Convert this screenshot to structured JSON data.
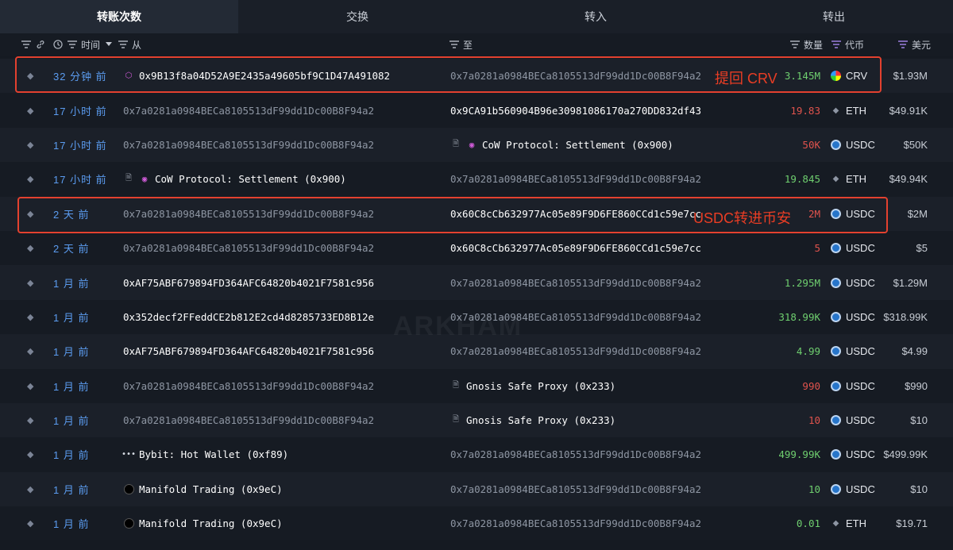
{
  "tabs": [
    "转账次数",
    "交换",
    "转入",
    "转出"
  ],
  "header": {
    "time": "时间",
    "from": "从",
    "to": "至",
    "amount": "数量",
    "token": "代币",
    "usd": "美元"
  },
  "watermark": "ARKHAM",
  "annotations": {
    "crv": "提回 CRV",
    "usdc": "USDC转进币安"
  },
  "colors": {
    "accent_time": "#5b9cf0",
    "in_amount": "#6fcf6f",
    "out_amount": "#e0534d",
    "callout": "#e3412f"
  },
  "rows": [
    {
      "time": "32 分钟 前",
      "from": "0x9B13f8a04D52A9E2435a49605bf9C1D47A491082",
      "from_icon": "hex-icon",
      "to": "0x7a0281a0984BECa8105513dF99dd1Dc00B8F94a2",
      "amount": "3.145M",
      "direction": "in",
      "token": "CRV",
      "usd": "$1.93M"
    },
    {
      "time": "17 小时 前",
      "from": "0x7a0281a0984BECa8105513dF99dd1Dc00B8F94a2",
      "to": "0x9CA91b560904B96e30981086170a270DD832df43",
      "amount": "19.83",
      "direction": "out",
      "token": "ETH",
      "usd": "$49.91K"
    },
    {
      "time": "17 小时 前",
      "from": "0x7a0281a0984BECa8105513dF99dd1Dc00B8F94a2",
      "to": "CoW Protocol: Settlement (0x900)",
      "to_icon": "cow",
      "amount": "50K",
      "direction": "out",
      "token": "USDC",
      "usd": "$50K"
    },
    {
      "time": "17 小时 前",
      "from": "CoW Protocol: Settlement (0x900)",
      "from_icon": "cow",
      "to": "0x7a0281a0984BECa8105513dF99dd1Dc00B8F94a2",
      "amount": "19.845",
      "direction": "in",
      "token": "ETH",
      "usd": "$49.94K"
    },
    {
      "time": "2 天 前",
      "from": "0x7a0281a0984BECa8105513dF99dd1Dc00B8F94a2",
      "to": "0x60C8cCb632977Ac05e89F9D6FE860CCd1c59e7cc",
      "amount": "2M",
      "direction": "out",
      "token": "USDC",
      "usd": "$2M"
    },
    {
      "time": "2 天 前",
      "from": "0x7a0281a0984BECa8105513dF99dd1Dc00B8F94a2",
      "to": "0x60C8cCb632977Ac05e89F9D6FE860CCd1c59e7cc",
      "amount": "5",
      "direction": "out",
      "token": "USDC",
      "usd": "$5"
    },
    {
      "time": "1 月 前",
      "from": "0xAF75ABF679894FD364AFC64820b4021F7581c956",
      "to": "0x7a0281a0984BECa8105513dF99dd1Dc00B8F94a2",
      "amount": "1.295M",
      "direction": "in",
      "token": "USDC",
      "usd": "$1.29M"
    },
    {
      "time": "1 月 前",
      "from": "0x352decf2FFeddCE2b812E2cd4d8285733ED8B12e",
      "to": "0x7a0281a0984BECa8105513dF99dd1Dc00B8F94a2",
      "amount": "318.99K",
      "direction": "in",
      "token": "USDC",
      "usd": "$318.99K"
    },
    {
      "time": "1 月 前",
      "from": "0xAF75ABF679894FD364AFC64820b4021F7581c956",
      "to": "0x7a0281a0984BECa8105513dF99dd1Dc00B8F94a2",
      "amount": "4.99",
      "direction": "in",
      "token": "USDC",
      "usd": "$4.99"
    },
    {
      "time": "1 月 前",
      "from": "0x7a0281a0984BECa8105513dF99dd1Dc00B8F94a2",
      "to": "Gnosis Safe Proxy (0x233)",
      "to_icon": "doc",
      "amount": "990",
      "direction": "out",
      "token": "USDC",
      "usd": "$990"
    },
    {
      "time": "1 月 前",
      "from": "0x7a0281a0984BECa8105513dF99dd1Dc00B8F94a2",
      "to": "Gnosis Safe Proxy (0x233)",
      "to_icon": "doc",
      "amount": "10",
      "direction": "out",
      "token": "USDC",
      "usd": "$10"
    },
    {
      "time": "1 月 前",
      "from": "Bybit: Hot Wallet (0xf89)",
      "from_icon": "bybit",
      "to": "0x7a0281a0984BECa8105513dF99dd1Dc00B8F94a2",
      "amount": "499.99K",
      "direction": "in",
      "token": "USDC",
      "usd": "$499.99K"
    },
    {
      "time": "1 月 前",
      "from": "Manifold Trading (0x9eC)",
      "from_icon": "manifold",
      "to": "0x7a0281a0984BECa8105513dF99dd1Dc00B8F94a2",
      "amount": "10",
      "direction": "in",
      "token": "USDC",
      "usd": "$10"
    },
    {
      "time": "1 月 前",
      "from": "Manifold Trading (0x9eC)",
      "from_icon": "manifold",
      "to": "0x7a0281a0984BECa8105513dF99dd1Dc00B8F94a2",
      "amount": "0.01",
      "direction": "in",
      "token": "ETH",
      "usd": "$19.71"
    }
  ]
}
